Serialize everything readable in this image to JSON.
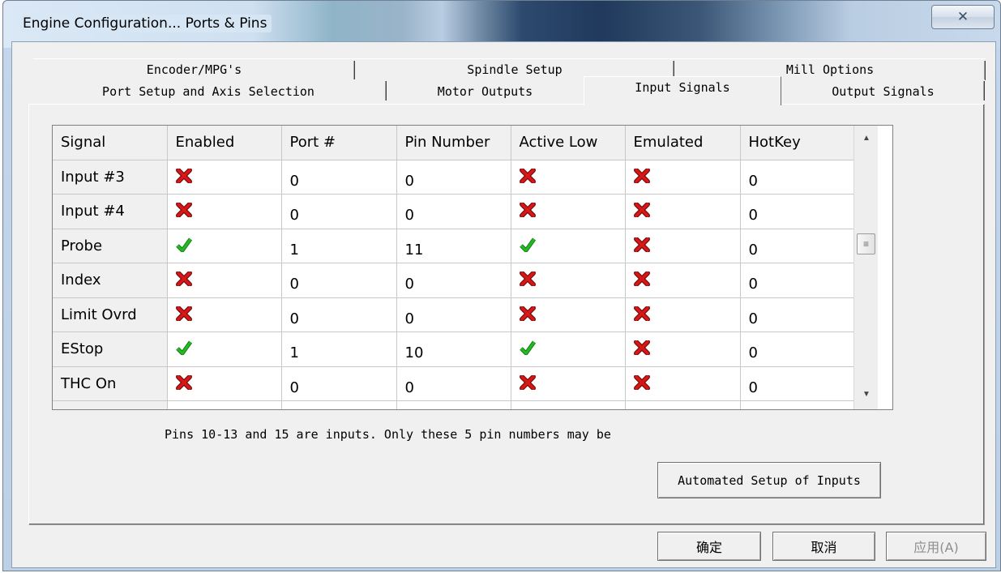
{
  "window": {
    "title": "Engine Configuration... Ports & Pins",
    "close_icon": "close-icon"
  },
  "tabs_row1": [
    {
      "label": "Encoder/MPG's"
    },
    {
      "label": "Spindle Setup"
    },
    {
      "label": "Mill Options"
    }
  ],
  "tabs_row2": [
    {
      "label": "Port Setup and Axis Selection"
    },
    {
      "label": "Motor Outputs"
    },
    {
      "label": "Input Signals",
      "selected": true
    },
    {
      "label": "Output Signals"
    }
  ],
  "grid": {
    "columns": [
      "Signal",
      "Enabled",
      "Port #",
      "Pin Number",
      "Active Low",
      "Emulated",
      "HotKey"
    ],
    "rows": [
      {
        "signal": "Input #3",
        "enabled": false,
        "port": "0",
        "pin": "0",
        "active_low": false,
        "emulated": false,
        "hotkey": "0"
      },
      {
        "signal": "Input #4",
        "enabled": false,
        "port": "0",
        "pin": "0",
        "active_low": false,
        "emulated": false,
        "hotkey": "0"
      },
      {
        "signal": "Probe",
        "enabled": true,
        "port": "1",
        "pin": "11",
        "active_low": true,
        "emulated": false,
        "hotkey": "0"
      },
      {
        "signal": "Index",
        "enabled": false,
        "port": "0",
        "pin": "0",
        "active_low": false,
        "emulated": false,
        "hotkey": "0"
      },
      {
        "signal": "Limit Ovrd",
        "enabled": false,
        "port": "0",
        "pin": "0",
        "active_low": false,
        "emulated": false,
        "hotkey": "0"
      },
      {
        "signal": "EStop",
        "enabled": true,
        "port": "1",
        "pin": "10",
        "active_low": true,
        "emulated": false,
        "hotkey": "0"
      },
      {
        "signal": "THC On",
        "enabled": false,
        "port": "0",
        "pin": "0",
        "active_low": false,
        "emulated": false,
        "hotkey": "0"
      }
    ],
    "icons": {
      "true": "green-check-icon",
      "false": "red-x-icon"
    },
    "colors": {
      "check": "#22bb22",
      "cross": "#d81818"
    }
  },
  "hint": "Pins 10-13 and 15 are inputs. Only these 5 pin numbers may be",
  "buttons": {
    "auto_setup": "Automated Setup of Inputs",
    "ok": "确定",
    "cancel": "取消",
    "apply": "应用(A)"
  }
}
